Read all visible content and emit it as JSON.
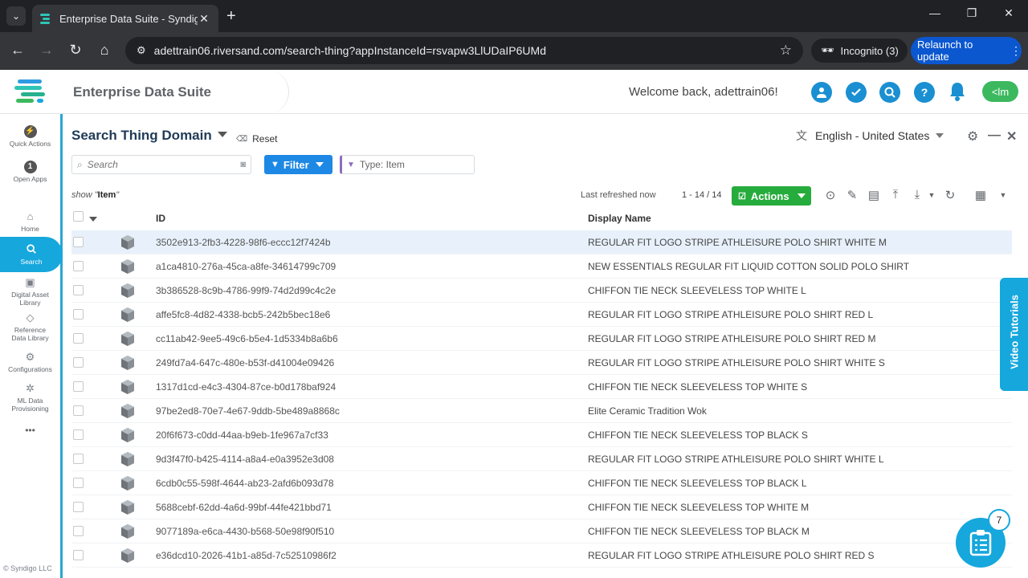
{
  "browser": {
    "tab_title": "Enterprise Data Suite - Syndigo",
    "url": "adettrain06.riversand.com/search-thing?appInstanceId=rsvapw3LlUDaIP6UMd",
    "incognito_label": "Incognito (3)",
    "relaunch_label": "Relaunch to update"
  },
  "header": {
    "app_title": "Enterprise Data Suite",
    "welcome": "Welcome back,  adettrain06!",
    "user_button": "<lm"
  },
  "leftnav": {
    "quick_actions": "Quick Actions",
    "open_apps": "Open Apps",
    "open_apps_count": "1",
    "home": "Home",
    "search": "Search",
    "dal_line1": "Digital Asset",
    "dal_line2": "Library",
    "rdl_line1": "Reference",
    "rdl_line2": "Data Library",
    "configurations": "Configurations",
    "ml_line1": "ML Data",
    "ml_line2": "Provisioning",
    "more": "•••",
    "copyright": "© Syndigo LLC"
  },
  "page": {
    "title": "Search Thing Domain",
    "reset": "Reset",
    "language": "English - United States",
    "search_placeholder": "Search",
    "filter_label": "Filter",
    "type_filter": "Type: Item",
    "show_prefix": "show \"",
    "show_value": "Item",
    "show_suffix": "\"",
    "last_refreshed": "Last refreshed now",
    "count": "1 - 14 / 14",
    "actions_label": "Actions",
    "columns": {
      "id": "ID",
      "display_name": "Display Name"
    }
  },
  "rows": [
    {
      "id": "3502e913-2fb3-4228-98f6-eccc12f7424b",
      "name": "REGULAR FIT LOGO STRIPE ATHLEISURE POLO SHIRT WHITE M"
    },
    {
      "id": "a1ca4810-276a-45ca-a8fe-34614799c709",
      "name": "NEW ESSENTIALS REGULAR FIT LIQUID COTTON SOLID POLO SHIRT"
    },
    {
      "id": "3b386528-8c9b-4786-99f9-74d2d99c4c2e",
      "name": "CHIFFON TIE NECK SLEEVELESS TOP WHITE L"
    },
    {
      "id": "affe5fc8-4d82-4338-bcb5-242b5bec18e6",
      "name": "REGULAR FIT LOGO STRIPE ATHLEISURE POLO SHIRT RED L"
    },
    {
      "id": "cc11ab42-9ee5-49c6-b5e4-1d5334b8a6b6",
      "name": "REGULAR FIT LOGO STRIPE ATHLEISURE POLO SHIRT RED M"
    },
    {
      "id": "249fd7a4-647c-480e-b53f-d41004e09426",
      "name": "REGULAR FIT LOGO STRIPE ATHLEISURE POLO SHIRT WHITE S"
    },
    {
      "id": "1317d1cd-e4c3-4304-87ce-b0d178baf924",
      "name": "CHIFFON TIE NECK SLEEVELESS TOP WHITE S"
    },
    {
      "id": "97be2ed8-70e7-4e67-9ddb-5be489a8868c",
      "name": "Elite Ceramic Tradition Wok"
    },
    {
      "id": "20f6f673-c0dd-44aa-b9eb-1fe967a7cf33",
      "name": "CHIFFON TIE NECK SLEEVELESS TOP BLACK S"
    },
    {
      "id": "9d3f47f0-b425-4114-a8a4-e0a3952e3d08",
      "name": "REGULAR FIT LOGO STRIPE ATHLEISURE POLO SHIRT WHITE L"
    },
    {
      "id": "6cdb0c55-598f-4644-ab23-2afd6b093d78",
      "name": "CHIFFON TIE NECK SLEEVELESS TOP BLACK L"
    },
    {
      "id": "5688cebf-62dd-4a6d-99bf-44fe421bbd71",
      "name": "CHIFFON TIE NECK SLEEVELESS TOP WHITE M"
    },
    {
      "id": "9077189a-e6ca-4430-b568-50e98f90f510",
      "name": "CHIFFON TIE NECK SLEEVELESS TOP BLACK M"
    },
    {
      "id": "e36dcd10-2026-41b1-a85d-7c52510986f2",
      "name": "REGULAR FIT LOGO STRIPE ATHLEISURE POLO SHIRT RED S"
    }
  ],
  "video_tutorials": "Video Tutorials",
  "fab_badge": "7",
  "colors": {
    "accent": "#16a7dd",
    "filter_blue": "#1e88e5",
    "actions_green": "#26ac3c",
    "user_green": "#3cb95f"
  }
}
